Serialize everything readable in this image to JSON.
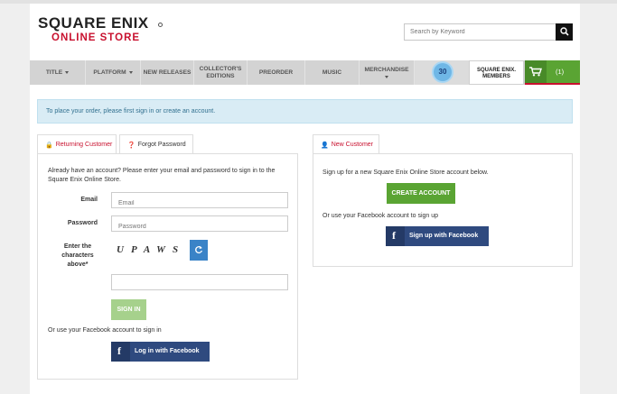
{
  "header": {
    "logo_line1": "SQUARE ENIX",
    "logo_line2": "ONLINE STORE",
    "search_placeholder": "Search by Keyword"
  },
  "nav": {
    "items": [
      {
        "label": "TITLE",
        "dropdown": true
      },
      {
        "label": "PLATFORM",
        "dropdown": true
      },
      {
        "label": "NEW RELEASES",
        "dropdown": false
      },
      {
        "label": "COLLECTOR'S EDITIONS",
        "dropdown": false
      },
      {
        "label": "PREORDER",
        "dropdown": false
      },
      {
        "label": "MUSIC",
        "dropdown": false
      },
      {
        "label": "MERCHANDISE",
        "dropdown": true
      }
    ],
    "ff_banner_number": "30",
    "members_label": "SQUARE ENIX. MEMBERS",
    "cart_count": "(1)"
  },
  "notice": "To place your order, please first sign in or create an account.",
  "left": {
    "tab_returning": "Returning Customer",
    "tab_forgot": "Forgot Password",
    "intro": "Already have an account? Please enter your email and password to sign in to the Square Enix Online Store.",
    "email_label": "Email",
    "email_placeholder": "Email",
    "password_label": "Password",
    "password_placeholder": "Password",
    "captcha_label": "Enter the characters above*",
    "captcha_text": "UPAWS",
    "sign_in": "SIGN IN",
    "fb_prompt": "Or use your Facebook account to sign in",
    "fb_button": "Log in with Facebook"
  },
  "right": {
    "tab_new": "New Customer",
    "intro": "Sign up for a new Square Enix Online Store account below.",
    "create": "CREATE ACCOUNT",
    "fb_prompt": "Or use your Facebook account to sign up",
    "fb_button": "Sign up with Facebook"
  },
  "colors": {
    "brand_red": "#c8102e",
    "green": "#5aa433",
    "facebook": "#2f4a7f",
    "notice_bg": "#d9ecf5"
  }
}
